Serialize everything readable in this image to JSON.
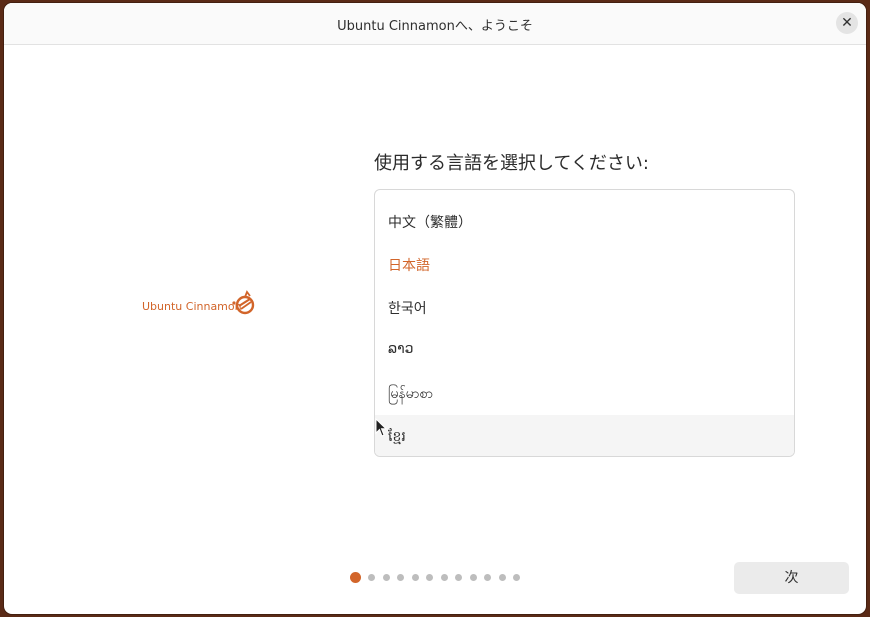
{
  "window": {
    "title": "Ubuntu Cinnamonへ、ようこそ",
    "close_label": "✕"
  },
  "logo": {
    "text": "Ubuntu Cinnamon",
    "color": "#d2652a"
  },
  "main": {
    "heading": "使用する言語を選択してください:",
    "languages": [
      {
        "label": "中文（繁體）"
      },
      {
        "label": "日本語",
        "selected": true
      },
      {
        "label": "한국어"
      },
      {
        "label": "ລາວ"
      },
      {
        "label": "မြန်မာစာ"
      },
      {
        "label": "ខ្មែរ"
      }
    ]
  },
  "pagination": {
    "total_steps": 12,
    "current_step": 1
  },
  "footer": {
    "next_label": "次"
  },
  "colors": {
    "accent": "#d2652a",
    "background": "#ffffff"
  }
}
